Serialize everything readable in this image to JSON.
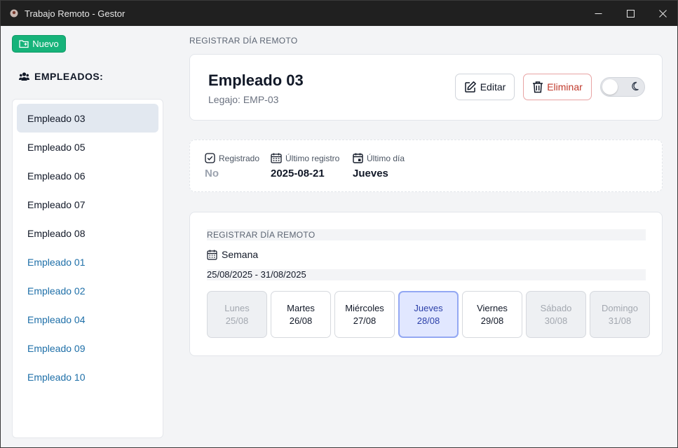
{
  "window": {
    "title": "Trabajo Remoto - Gestor"
  },
  "sidebar": {
    "new_button": "Nuevo",
    "heading": "EMPLEADOS:",
    "employees": [
      {
        "name": "Empleado 03",
        "state": "active"
      },
      {
        "name": "Empleado 05",
        "state": "normal"
      },
      {
        "name": "Empleado 06",
        "state": "normal"
      },
      {
        "name": "Empleado 07",
        "state": "normal"
      },
      {
        "name": "Empleado 08",
        "state": "normal"
      },
      {
        "name": "Empleado 01",
        "state": "blue"
      },
      {
        "name": "Empleado 02",
        "state": "blue"
      },
      {
        "name": "Empleado 04",
        "state": "blue"
      },
      {
        "name": "Empleado 09",
        "state": "blue"
      },
      {
        "name": "Empleado 10",
        "state": "blue"
      }
    ]
  },
  "main": {
    "section_label": "REGISTRAR DÍA REMOTO",
    "employee": {
      "name": "Empleado 03",
      "legajo": "Legajo: EMP-03"
    },
    "edit_button": "Editar",
    "delete_button": "Eliminar",
    "stats": {
      "registered_label": "Registrado",
      "registered_value": "No",
      "last_record_label": "Último registro",
      "last_record_value": "2025-08-21",
      "last_day_label": "Último día",
      "last_day_value": "Jueves"
    },
    "week": {
      "label": "REGISTRAR DÍA REMOTO",
      "title": "Semana",
      "range": "25/08/2025 - 31/08/2025",
      "days": [
        {
          "name": "Lunes",
          "date": "25/08",
          "state": "disabled"
        },
        {
          "name": "Martes",
          "date": "26/08",
          "state": "normal"
        },
        {
          "name": "Miércoles",
          "date": "27/08",
          "state": "normal"
        },
        {
          "name": "Jueves",
          "date": "28/08",
          "state": "selected"
        },
        {
          "name": "Viernes",
          "date": "29/08",
          "state": "normal"
        },
        {
          "name": "Sábado",
          "date": "30/08",
          "state": "disabled"
        },
        {
          "name": "Domingo",
          "date": "31/08",
          "state": "disabled"
        }
      ]
    }
  }
}
